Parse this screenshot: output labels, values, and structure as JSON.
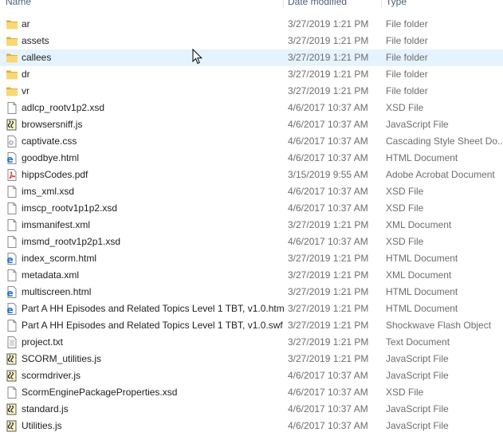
{
  "header": {
    "name_label": "Name",
    "date_label": "Date modified",
    "type_label": "Type"
  },
  "files": [
    {
      "name": "ar",
      "date": "3/27/2019 1:21 PM",
      "type": "File folder",
      "icon": "folder-icon"
    },
    {
      "name": "assets",
      "date": "3/27/2019 1:21 PM",
      "type": "File folder",
      "icon": "folder-icon"
    },
    {
      "name": "callees",
      "date": "3/27/2019 1:21 PM",
      "type": "File folder",
      "icon": "folder-icon"
    },
    {
      "name": "dr",
      "date": "3/27/2019 1:21 PM",
      "type": "File folder",
      "icon": "folder-icon"
    },
    {
      "name": "vr",
      "date": "3/27/2019 1:21 PM",
      "type": "File folder",
      "icon": "folder-icon"
    },
    {
      "name": "adlcp_rootv1p2.xsd",
      "date": "4/6/2017 10:37 AM",
      "type": "XSD File",
      "icon": "generic-file-icon"
    },
    {
      "name": "browsersniff.js",
      "date": "4/6/2017 10:37 AM",
      "type": "JavaScript File",
      "icon": "script-file-icon"
    },
    {
      "name": "captivate.css",
      "date": "4/6/2017 10:37 AM",
      "type": "Cascading Style Sheet Do...",
      "icon": "css-file-icon"
    },
    {
      "name": "goodbye.html",
      "date": "4/6/2017 10:37 AM",
      "type": "HTML Document",
      "icon": "html-file-icon"
    },
    {
      "name": "hippsCodes.pdf",
      "date": "3/15/2019 9:55 AM",
      "type": "Adobe Acrobat Document",
      "icon": "pdf-file-icon"
    },
    {
      "name": "ims_xml.xsd",
      "date": "4/6/2017 10:37 AM",
      "type": "XSD File",
      "icon": "generic-file-icon"
    },
    {
      "name": "imscp_rootv1p1p2.xsd",
      "date": "4/6/2017 10:37 AM",
      "type": "XSD File",
      "icon": "generic-file-icon"
    },
    {
      "name": "imsmanifest.xml",
      "date": "3/27/2019 1:21 PM",
      "type": "XML Document",
      "icon": "generic-file-icon"
    },
    {
      "name": "imsmd_rootv1p2p1.xsd",
      "date": "4/6/2017 10:37 AM",
      "type": "XSD File",
      "icon": "generic-file-icon"
    },
    {
      "name": "index_scorm.html",
      "date": "3/27/2019 1:21 PM",
      "type": "HTML Document",
      "icon": "html-file-icon"
    },
    {
      "name": "metadata.xml",
      "date": "3/27/2019 1:21 PM",
      "type": "XML Document",
      "icon": "generic-file-icon"
    },
    {
      "name": "multiscreen.html",
      "date": "3/27/2019 1:21 PM",
      "type": "HTML Document",
      "icon": "html-file-icon"
    },
    {
      "name": "Part A HH Episodes and Related Topics Level 1 TBT, v1.0.htm",
      "date": "3/27/2019 1:21 PM",
      "type": "HTML Document",
      "icon": "html-file-icon"
    },
    {
      "name": "Part A HH Episodes and Related Topics Level 1 TBT, v1.0.swf",
      "date": "3/27/2019 1:21 PM",
      "type": "Shockwave Flash Object",
      "icon": "generic-file-icon"
    },
    {
      "name": "project.txt",
      "date": "3/27/2019 1:21 PM",
      "type": "Text Document",
      "icon": "text-file-icon"
    },
    {
      "name": "SCORM_utilities.js",
      "date": "3/27/2019 1:21 PM",
      "type": "JavaScript File",
      "icon": "script-file-icon"
    },
    {
      "name": "scormdriver.js",
      "date": "4/6/2017 10:37 AM",
      "type": "JavaScript File",
      "icon": "script-file-icon"
    },
    {
      "name": "ScormEnginePackageProperties.xsd",
      "date": "4/6/2017 10:37 AM",
      "type": "XSD File",
      "icon": "generic-file-icon"
    },
    {
      "name": "standard.js",
      "date": "4/6/2017 10:37 AM",
      "type": "JavaScript File",
      "icon": "script-file-icon"
    },
    {
      "name": "Utilities.js",
      "date": "4/6/2017 10:37 AM",
      "type": "JavaScript File",
      "icon": "script-file-icon"
    }
  ],
  "hover_row": 2,
  "colors": {
    "hover_bg": "#e5f3ff",
    "folder": "#f8d775",
    "folder_dark": "#e0b03c",
    "ie_blue": "#1e73d2",
    "pdf_red": "#d42a2a",
    "text": "#1e1e1e",
    "muted": "#6d6d6d"
  }
}
